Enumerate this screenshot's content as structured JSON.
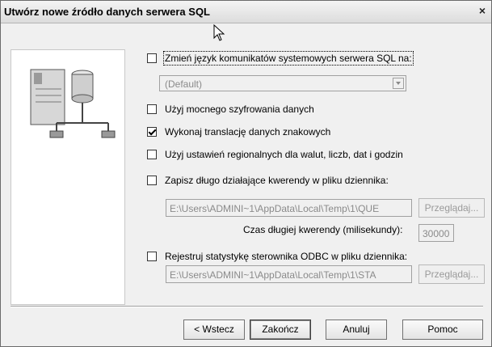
{
  "window": {
    "title": "Utwórz nowe źródło danych serwera SQL",
    "close_label": "×"
  },
  "options": {
    "change_language": {
      "label": "Zmień język komunikatów systemowych serwera SQL na:",
      "checked": false
    },
    "language_select": {
      "value": "(Default)"
    },
    "strong_encryption": {
      "label": "Użyj mocnego szyfrowania danych",
      "checked": false
    },
    "char_translation": {
      "label": "Wykonaj translację danych znakowych",
      "checked": true
    },
    "regional_settings": {
      "label": "Użyj ustawień regionalnych dla walut, liczb, dat i godzin",
      "checked": false
    },
    "save_long_queries": {
      "label": "Zapisz długo działające kwerendy w pliku dziennika:",
      "checked": false
    },
    "queries_log_path": "E:\\Users\\ADMINI~1\\AppData\\Local\\Temp\\1\\QUE",
    "browse_queries_label": "Przeglądaj...",
    "long_query_time_label": "Czas długiej kwerendy (milisekundy):",
    "long_query_time_value": "30000",
    "log_odbc_stats": {
      "label": "Rejestruj statystykę sterownika ODBC w pliku dziennika:",
      "checked": false
    },
    "stats_log_path": "E:\\Users\\ADMINI~1\\AppData\\Local\\Temp\\1\\STA",
    "browse_stats_label": "Przeglądaj..."
  },
  "buttons": {
    "back": "< Wstecz",
    "finish": "Zakończ",
    "cancel": "Anuluj",
    "help": "Pomoc"
  }
}
